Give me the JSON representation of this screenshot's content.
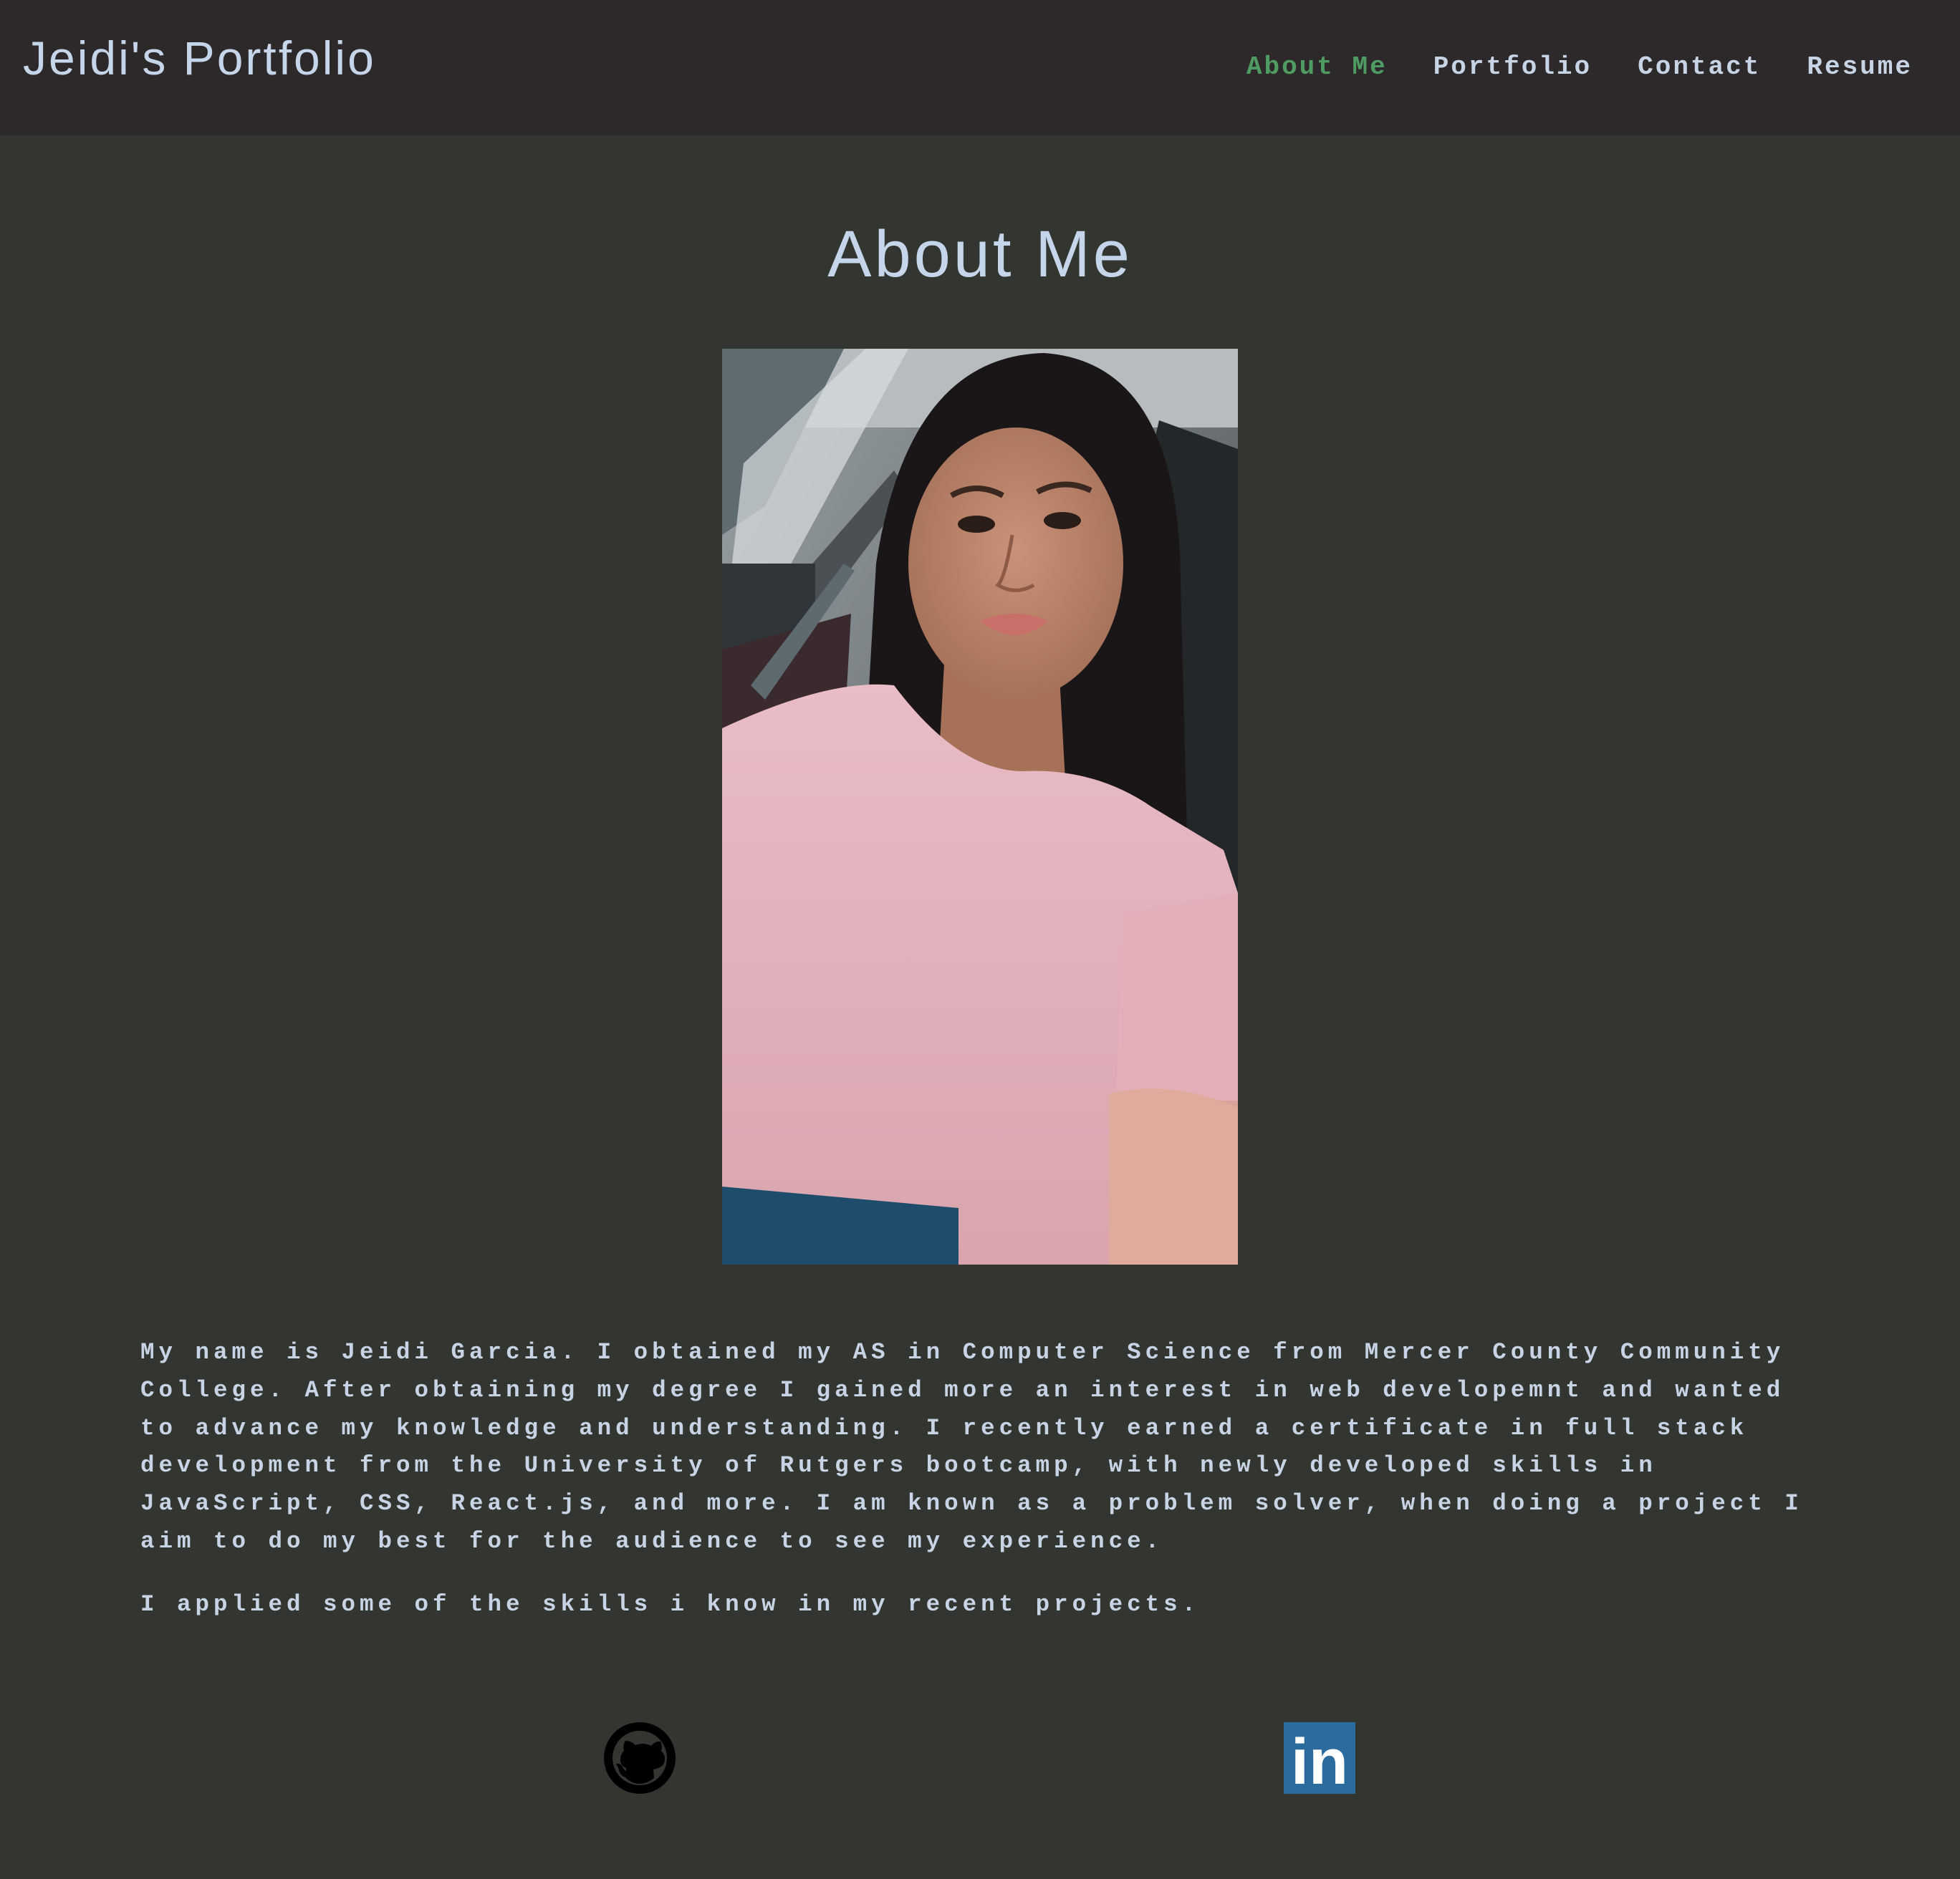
{
  "header": {
    "brand": "Jeidi's Portfolio",
    "nav": [
      {
        "label": "About Me",
        "active": true
      },
      {
        "label": "Portfolio",
        "active": false
      },
      {
        "label": "Contact",
        "active": false
      },
      {
        "label": "Resume",
        "active": false
      }
    ]
  },
  "main": {
    "title": "About Me",
    "bio_paragraph": "My name is Jeidi Garcia. I obtained my AS in Computer Science from Mercer County Community College. After obtaining my degree I gained more an interest in web developemnt and wanted to advance my knowledge and understanding. I recently earned a certificate in full stack development from the University of Rutgers bootcamp, with newly developed skills in JavaScript, CSS, React.js, and more. I am known as a problem solver, when doing a project I aim to do my best for the audience to see my experience.",
    "skills_paragraph": "I applied some of the skills i know in my recent projects.",
    "photo_icon": "profile-photo"
  },
  "social": {
    "github_icon": "github-icon",
    "linkedin_icon": "linkedin-icon",
    "linkedin_text": "in"
  },
  "colors": {
    "page_bg": "#333530",
    "header_bg": "#2d292b",
    "text": "#c7d4e6",
    "nav_active": "#4f9c63",
    "linkedin_blue": "#2c6b9e"
  }
}
